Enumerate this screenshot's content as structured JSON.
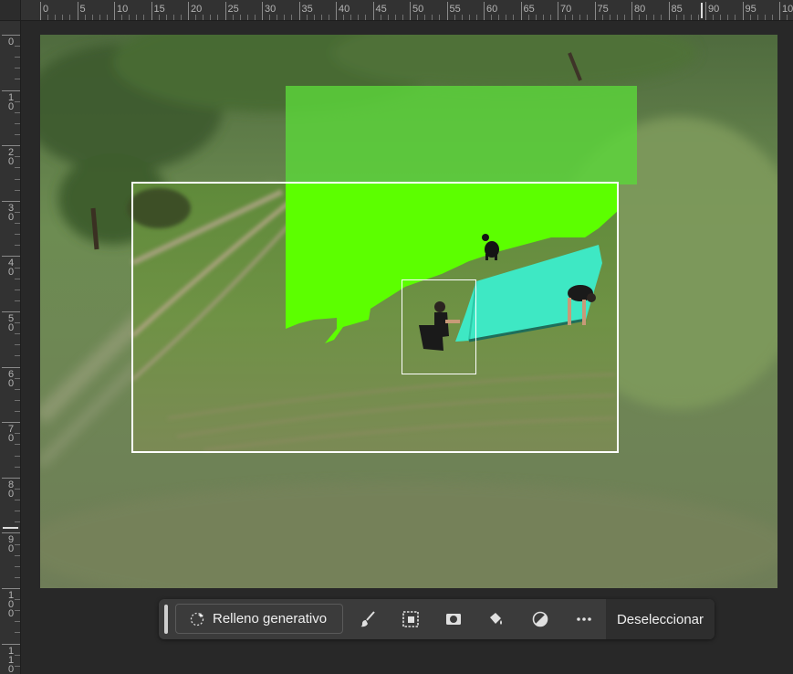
{
  "rulers": {
    "top_labels": [
      "0",
      "5",
      "10",
      "15",
      "20",
      "25",
      "30",
      "35",
      "40",
      "45",
      "50",
      "55",
      "60",
      "65",
      "70",
      "75",
      "80",
      "85",
      "90",
      "95",
      "100"
    ],
    "left_labels": [
      "0",
      "10",
      "20",
      "30",
      "40",
      "50",
      "60",
      "70",
      "80",
      "90",
      "100",
      "110"
    ]
  },
  "canvas": {
    "fill_color": "#5cff00",
    "tarp_color": "#3ee8c4"
  },
  "taskbar": {
    "generative_fill_label": "Relleno generativo",
    "icons": [
      "brush-icon",
      "selection-mask-icon",
      "mask-icon",
      "fill-bucket-icon",
      "adjustment-icon",
      "more-options-icon"
    ],
    "deselect_label": "Deseleccionar"
  }
}
